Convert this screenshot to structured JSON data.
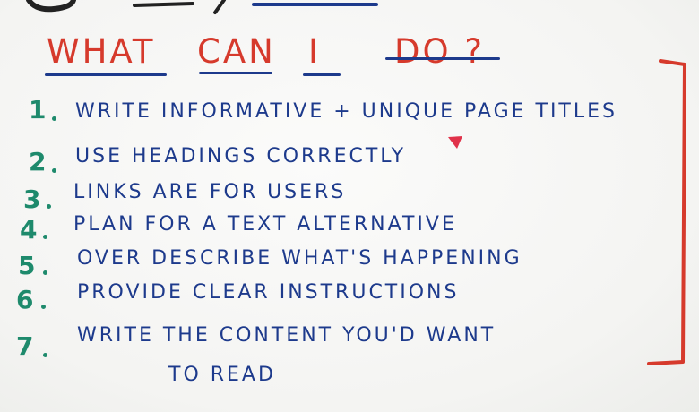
{
  "title": {
    "words": [
      "WHAT",
      "CAN",
      "I",
      "DO ?"
    ],
    "color": "#d63a2c",
    "underline_color": "#1d3a8c"
  },
  "list": {
    "number_color": "#1e8a6c",
    "text_color": "#1d3a8c",
    "items": [
      {
        "num": "1",
        "text": "WRITE INFORMATIVE + UNIQUE PAGE TITLES"
      },
      {
        "num": "2",
        "text": "USE HEADINGS CORRECTLY"
      },
      {
        "num": "3",
        "text": "LINKS ARE FOR USERS"
      },
      {
        "num": "4",
        "text": "PLAN FOR A TEXT ALTERNATIVE"
      },
      {
        "num": "5",
        "text": "OVER DESCRIBE WHAT'S HAPPENING"
      },
      {
        "num": "6",
        "text": "PROVIDE CLEAR INSTRUCTIONS"
      },
      {
        "num": "7",
        "text": "WRITE THE CONTENT YOU'D WANT"
      },
      {
        "num": "",
        "text": "TO READ"
      }
    ]
  },
  "bracket_color": "#d63a2c",
  "heart_mark_color": "#e0324a"
}
